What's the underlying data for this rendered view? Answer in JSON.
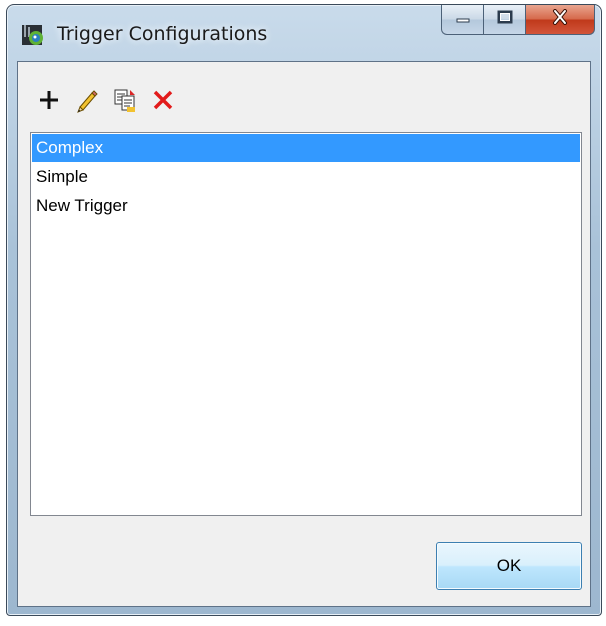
{
  "window": {
    "title": "Trigger Configurations",
    "icon": "app-icon",
    "caption_buttons": [
      "minimize-icon",
      "maximize-icon",
      "close-icon"
    ]
  },
  "toolbar": {
    "buttons": [
      {
        "name": "add-button",
        "icon": "plus-icon"
      },
      {
        "name": "edit-button",
        "icon": "pencil-icon"
      },
      {
        "name": "copy-button",
        "icon": "copy-icon"
      },
      {
        "name": "delete-button",
        "icon": "delete-x-icon"
      }
    ]
  },
  "list": {
    "items": [
      "Complex",
      "Simple",
      "New Trigger"
    ],
    "selected_index": 0
  },
  "footer": {
    "ok_label": "OK"
  },
  "colors": {
    "selection": "#3399ff",
    "delete_red": "#e21b1b",
    "close_button": "#c0391b"
  }
}
